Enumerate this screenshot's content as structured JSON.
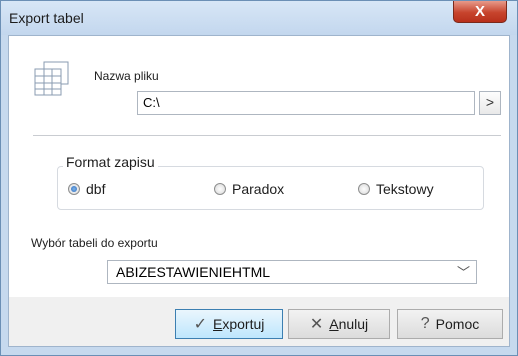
{
  "window": {
    "title": "Export tabel",
    "close_label": "X"
  },
  "file": {
    "label": "Nazwa pliku",
    "path_value": "C:\\",
    "browse_label": ">"
  },
  "format": {
    "legend": "Format zapisu",
    "options": [
      {
        "label": "dbf",
        "checked": true
      },
      {
        "label": "Paradox",
        "checked": false
      },
      {
        "label": "Tekstowy",
        "checked": false
      }
    ]
  },
  "table_select": {
    "label": "Wybór tabeli do exportu",
    "value": "ABIZESTAWIENIEHTML"
  },
  "buttons": {
    "export": {
      "icon": "checkmark-icon",
      "accel": "E",
      "rest": "xportuj"
    },
    "cancel": {
      "icon": "cross-icon",
      "accel": "A",
      "rest": "nuluj"
    },
    "help": {
      "icon": "help-circle-icon",
      "label": "Pomoc"
    }
  }
}
